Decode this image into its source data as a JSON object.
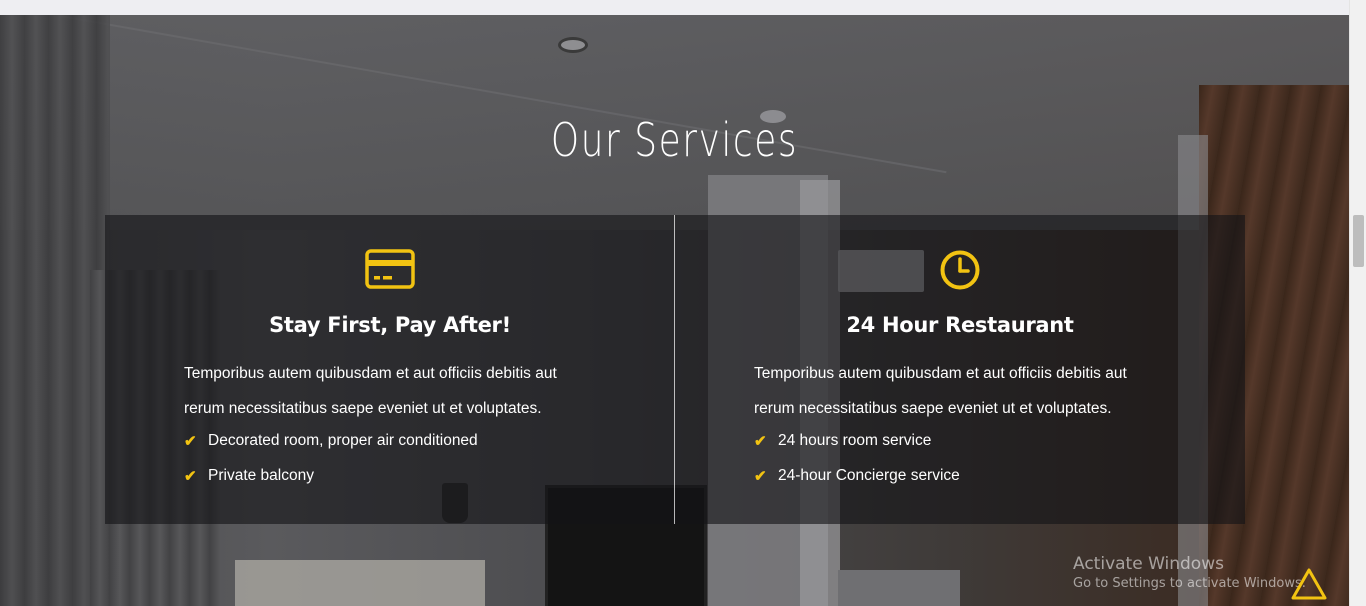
{
  "section": {
    "title": "Our Services"
  },
  "services": [
    {
      "icon": "credit-card-icon",
      "title": "Stay First, Pay After!",
      "description_line1": "Temporibus autem quibusdam et aut officiis debitis aut",
      "description_line2": "rerum necessitatibus saepe eveniet ut et voluptates.",
      "features": [
        "Decorated room, proper air conditioned",
        "Private balcony"
      ]
    },
    {
      "icon": "clock-icon",
      "title": "24 Hour Restaurant",
      "description_line1": "Temporibus autem quibusdam et aut officiis debitis aut",
      "description_line2": "rerum necessitatibus saepe eveniet ut et voluptates.",
      "features": [
        "24 hours room service",
        "24-hour Concierge service"
      ]
    }
  ],
  "watermark": {
    "line1": "Activate Windows",
    "line2": "Go to Settings to activate Windows."
  },
  "colors": {
    "accent": "#f2c312",
    "card_bg": "rgba(20,20,22,0.62)",
    "text": "#ffffff"
  }
}
